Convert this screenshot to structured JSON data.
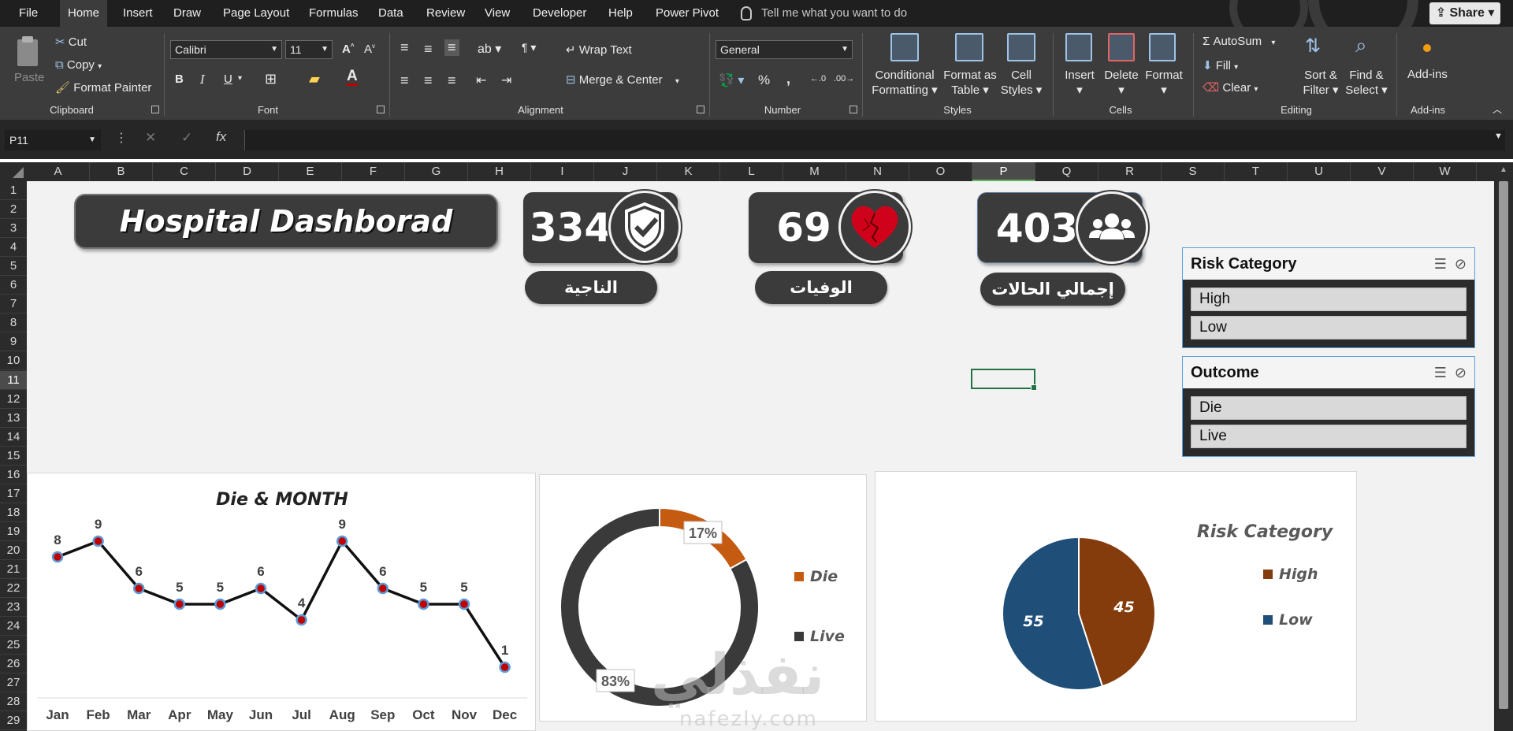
{
  "menu": {
    "tabs": [
      "File",
      "Home",
      "Insert",
      "Draw",
      "Page Layout",
      "Formulas",
      "Data",
      "Review",
      "View",
      "Developer",
      "Help",
      "Power Pivot"
    ],
    "tell_me": "Tell me what you want to do",
    "share": "Share"
  },
  "ribbon": {
    "clipboard": {
      "paste": "Paste",
      "cut": "Cut",
      "copy": "Copy",
      "format_painter": "Format Painter",
      "label": "Clipboard"
    },
    "font": {
      "name": "Calibri",
      "size": "11",
      "label": "Font",
      "bold": "B",
      "italic": "I",
      "underline": "U"
    },
    "alignment": {
      "wrap_text": "Wrap Text",
      "merge_center": "Merge & Center",
      "label": "Alignment"
    },
    "number": {
      "format": "General",
      "percent": "%",
      "comma": ",",
      "label": "Number"
    },
    "styles": {
      "conditional_1": "Conditional",
      "conditional_2": "Formatting",
      "format_as_1": "Format as",
      "format_as_2": "Table",
      "cell_styles_1": "Cell",
      "cell_styles_2": "Styles",
      "label": "Styles"
    },
    "cells": {
      "insert": "Insert",
      "delete": "Delete",
      "format": "Format",
      "label": "Cells"
    },
    "editing": {
      "autosum": "AutoSum",
      "fill": "Fill",
      "clear": "Clear",
      "sort_1": "Sort &",
      "sort_2": "Filter",
      "find_1": "Find &",
      "find_2": "Select",
      "label": "Editing"
    },
    "addins": {
      "btn": "Add-ins",
      "label": "Add-ins"
    }
  },
  "formula_bar": {
    "name_box": "P11",
    "fx": "fx",
    "cancel": "✕",
    "enter": "✓",
    "content": ""
  },
  "grid": {
    "columns": [
      "A",
      "B",
      "C",
      "D",
      "E",
      "F",
      "G",
      "H",
      "I",
      "J",
      "K",
      "L",
      "M",
      "N",
      "O",
      "P",
      "Q",
      "R",
      "S",
      "T",
      "U",
      "V",
      "W"
    ],
    "selected_column": "P",
    "rows": [
      "1",
      "2",
      "3",
      "4",
      "5",
      "6",
      "7",
      "8",
      "9",
      "10",
      "11",
      "12",
      "13",
      "14",
      "15",
      "16",
      "17",
      "18",
      "19",
      "20",
      "21",
      "22",
      "23",
      "24",
      "25",
      "26",
      "27",
      "28",
      "29"
    ],
    "selected_row": "11"
  },
  "dashboard": {
    "title": "Hospital Dashborad",
    "kpis": [
      {
        "value": "334",
        "label": "الناجية",
        "icon": "shield-check-icon"
      },
      {
        "value": "69",
        "label": "الوفيات",
        "icon": "broken-heart-icon"
      },
      {
        "value": "403",
        "label": "إجمالي الحالات",
        "icon": "users-icon"
      }
    ],
    "slicers": [
      {
        "title": "Risk Category",
        "items": [
          "High",
          "Low"
        ]
      },
      {
        "title": "Outcome",
        "items": [
          "Die",
          "Live"
        ]
      }
    ],
    "watermark": "نفذلي",
    "watermark_url": "nafezly.com"
  },
  "colors": {
    "accent_green": "#217346",
    "die": "#c55a11",
    "live": "#3a3a3a",
    "high": "#843c0c",
    "low": "#1f4e79",
    "line": "#111111",
    "marker_fill": "#c00000",
    "marker_ring": "#5b9bd5"
  },
  "chart_data": [
    {
      "type": "line",
      "title": "Die  & MONTH",
      "categories": [
        "Jan",
        "Feb",
        "Mar",
        "Apr",
        "May",
        "Jun",
        "Jul",
        "Aug",
        "Sep",
        "Oct",
        "Nov",
        "Dec"
      ],
      "series": [
        {
          "values": [
            8,
            9,
            6,
            5,
            5,
            6,
            4,
            9,
            6,
            5,
            5,
            1
          ]
        }
      ],
      "data_labels": true,
      "ylim": [
        0,
        10
      ],
      "grid": false
    },
    {
      "type": "pie",
      "subtype": "doughnut",
      "title": "",
      "categories": [
        "Die",
        "Live"
      ],
      "values": [
        17,
        83
      ],
      "data_labels": [
        "17%",
        "83%"
      ],
      "legend": "right"
    },
    {
      "type": "pie",
      "title": "Risk Category",
      "categories": [
        "High",
        "Low"
      ],
      "values": [
        45,
        55
      ],
      "data_labels": [
        "45",
        "55"
      ],
      "legend": "right"
    }
  ]
}
